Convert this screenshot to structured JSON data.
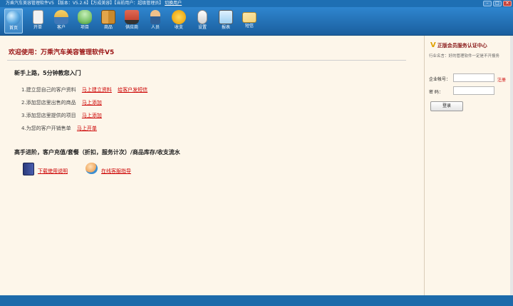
{
  "titlebar": {
    "title": "万乘汽车美容管理软件V5 【版本：V5.2.6】【万成美容】【当前用户：超级管理员】",
    "switch_user": "切换用户",
    "buttons": [
      "–",
      "□",
      "✕"
    ]
  },
  "toolbar": {
    "items": [
      {
        "label": "首页",
        "icon": "home-globe-icon",
        "color": "#57a6e0"
      },
      {
        "label": "开单",
        "icon": "clipboard-icon",
        "color": "#f2f2f2"
      },
      {
        "label": "客户",
        "icon": "customers-icon",
        "color": "#e8b84a"
      },
      {
        "label": "项目",
        "icon": "robot-icon",
        "color": "#7cc36b"
      },
      {
        "label": "商品",
        "icon": "boxes-icon",
        "color": "#c9892d"
      },
      {
        "label": "供应商",
        "icon": "truck-icon",
        "color": "#c64532"
      },
      {
        "label": "人员",
        "icon": "person-icon",
        "color": "#f0c08a"
      },
      {
        "label": "收支",
        "icon": "coin-icon",
        "color": "#f2b21e"
      },
      {
        "label": "设置",
        "icon": "mouse-icon",
        "color": "#e6e6e6"
      },
      {
        "label": "报表",
        "icon": "chart-monitor-icon",
        "color": "#9fd0f0"
      },
      {
        "label": "短信",
        "icon": "envelope-icon",
        "color": "#f3d37a"
      }
    ]
  },
  "main": {
    "welcome": "欢迎使用：万乘汽车美容管理软件V5",
    "quick_title": "新手上路，5分钟教您入门",
    "steps": [
      {
        "text": "1.建立您自己的客户资料",
        "links": [
          "马上建立资料",
          "给客户发短信"
        ]
      },
      {
        "text": "2.添加您店里出售的商品",
        "links": [
          "马上添加"
        ]
      },
      {
        "text": "3.添加您店里提供的项目",
        "links": [
          "马上添加"
        ]
      },
      {
        "text": "4.为您的客户开销售单",
        "links": [
          "马上开单"
        ]
      }
    ],
    "advanced_title": "高手进阶，客户充值/套餐（折扣，服务计次）/商品库存/收支流水",
    "download_manual": "下载使用说明",
    "online_help": "在线客服指导"
  },
  "sidebar": {
    "title": "正版会员服务认证中心",
    "subtitle": "行业名言：好的管理软件一定是不开报务",
    "account_label": "企业帐号：",
    "password_label": "密    码：",
    "register": "注册",
    "login": "登录"
  }
}
